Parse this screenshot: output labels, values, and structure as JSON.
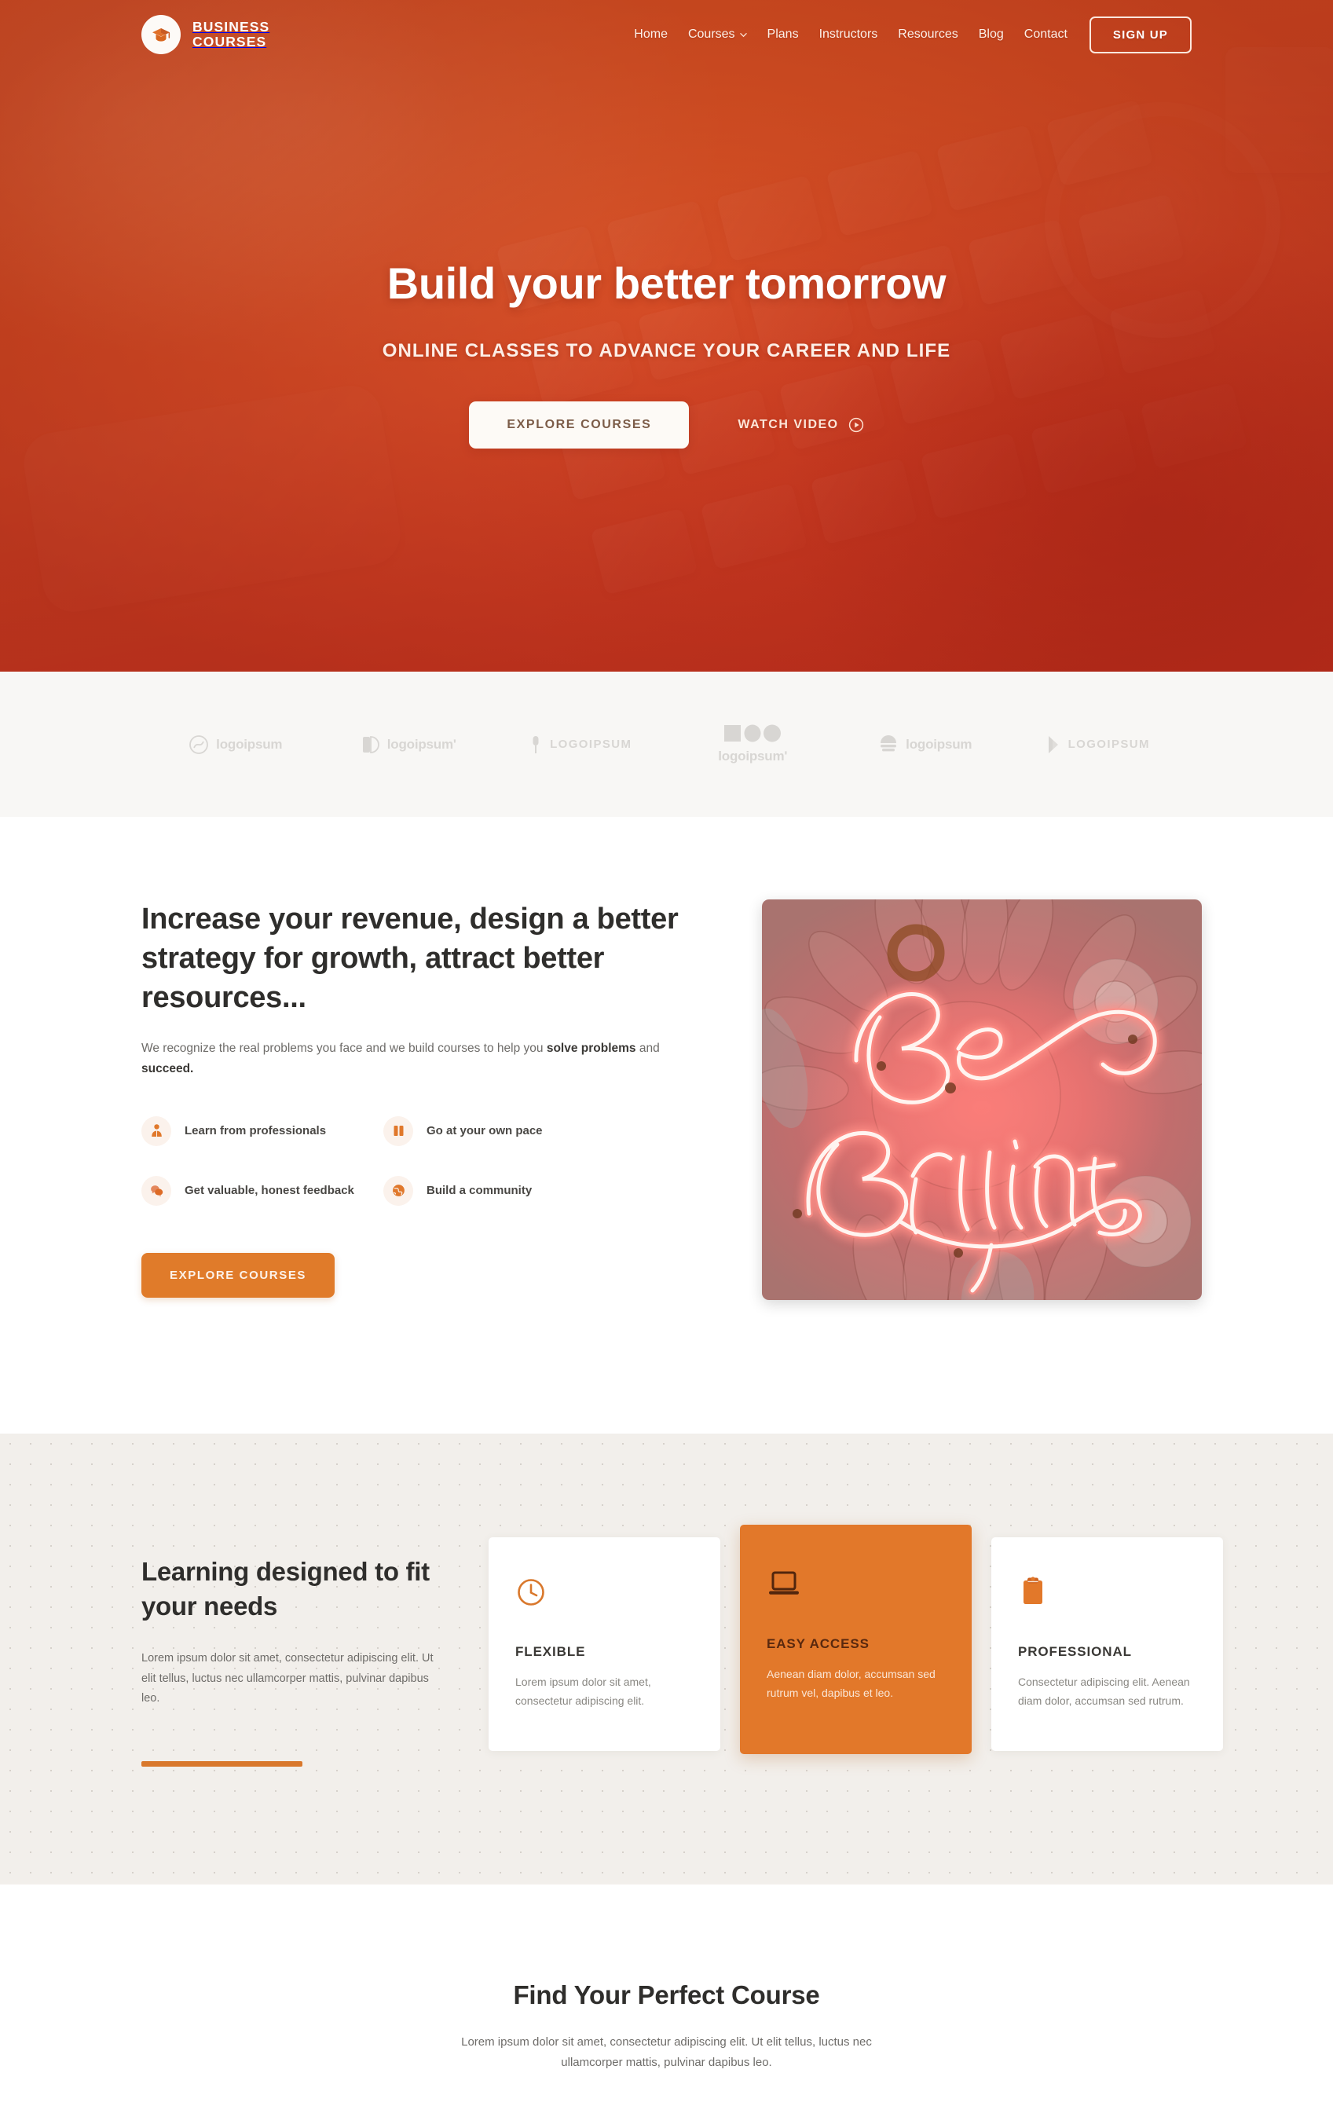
{
  "brand": {
    "line1": "BUSINESS",
    "line2": "COURSES",
    "logo_icon": "graduation-cap-icon"
  },
  "nav": {
    "links": [
      {
        "label": "Home",
        "has_caret": false
      },
      {
        "label": "Courses",
        "has_caret": true
      },
      {
        "label": "Plans",
        "has_caret": false
      },
      {
        "label": "Instructors",
        "has_caret": false
      },
      {
        "label": "Resources",
        "has_caret": false
      },
      {
        "label": "Blog",
        "has_caret": false
      },
      {
        "label": "Contact",
        "has_caret": false
      }
    ],
    "signup_label": "SIGN UP"
  },
  "hero": {
    "title": "Build your better tomorrow",
    "subtitle": "ONLINE CLASSES TO ADVANCE YOUR CAREER AND LIFE",
    "primary_cta": "EXPLORE COURSES",
    "secondary_cta": "WATCH VIDEO",
    "secondary_icon": "play-circle-icon",
    "bg_color_start": "#dd6224",
    "bg_color_end": "#c93420"
  },
  "logos": [
    {
      "name": "logoipsum",
      "style": "lower",
      "icon": "swirl-circle-icon"
    },
    {
      "name": "logoipsumʹ",
      "style": "lower",
      "icon": "split-square-icon"
    },
    {
      "name": "LOGOIPSUM",
      "style": "caps",
      "icon": "pin-icon"
    },
    {
      "name": "logoipsumʹ",
      "style": "stacked",
      "icon": "three-shapes-icon"
    },
    {
      "name": "logoipsum",
      "style": "lower",
      "icon": "stacked-cloud-icon"
    },
    {
      "name": "LOGOIPSUM",
      "style": "caps",
      "icon": "play-wedge-icon"
    }
  ],
  "revenue": {
    "title": "Increase your revenue, design a better strategy for growth, attract better resources...",
    "copy_before": "We recognize the real problems you face and we build courses to help you ",
    "copy_bold1": "solve problems",
    "copy_mid": " and ",
    "copy_bold2": "succeed.",
    "features": [
      {
        "label": "Learn from professionals",
        "icon": "person-icon"
      },
      {
        "label": "Go at your own pace",
        "icon": "pause-bars-icon"
      },
      {
        "label": "Get valuable, honest feedback",
        "icon": "chat-bubbles-icon"
      },
      {
        "label": "Build a community",
        "icon": "globe-icon"
      }
    ],
    "cta": "EXPLORE COURSES",
    "image_alt": "Be Brilliant",
    "image_text_line1": "Be",
    "image_text_line2": "Brilliant"
  },
  "learning": {
    "title": "Learning designed to fit your needs",
    "copy": "Lorem ipsum dolor sit amet, consectetur adipiscing elit. Ut elit tellus, luctus nec ullamcorper mattis, pulvinar dapibus leo.",
    "accent_color": "#d9782c",
    "cards": [
      {
        "title": "FLEXIBLE",
        "copy": "Lorem ipsum dolor sit amet, consectetur adipiscing elit.",
        "icon": "clock-icon",
        "highlighted": false
      },
      {
        "title": "EASY ACCESS",
        "copy": "Aenean diam dolor, accumsan sed rutrum vel, dapibus et leo.",
        "icon": "laptop-icon",
        "highlighted": true
      },
      {
        "title": "PROFESSIONAL",
        "copy": "Consectetur adipiscing elit. Aenean diam dolor, accumsan sed rutrum.",
        "icon": "clipboard-icon",
        "highlighted": false
      }
    ]
  },
  "find": {
    "title": "Find Your Perfect Course",
    "copy": "Lorem ipsum dolor sit amet, consectetur adipiscing elit. Ut elit tellus, luctus nec ullamcorper mattis, pulvinar dapibus leo."
  }
}
